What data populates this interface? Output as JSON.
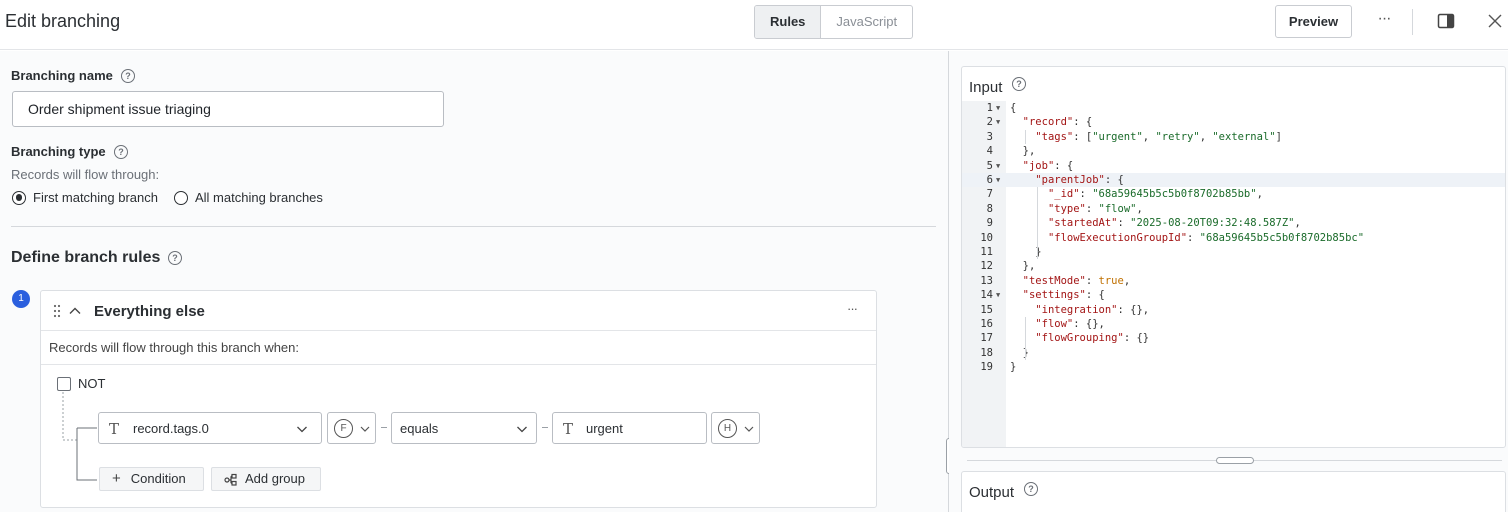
{
  "header": {
    "title": "Edit branching",
    "tabs": [
      {
        "label": "Rules",
        "active": true
      },
      {
        "label": "JavaScript",
        "active": false
      }
    ],
    "preview_label": "Preview",
    "more_label": "···"
  },
  "form": {
    "branching_name_label": "Branching name",
    "branching_name_value": "Order shipment issue triaging",
    "branching_type_label": "Branching type",
    "branching_type_hint": "Records will flow through:",
    "options": [
      {
        "label": "First matching branch",
        "selected": true
      },
      {
        "label": "All matching branches",
        "selected": false
      }
    ],
    "define_rules_title": "Define branch rules"
  },
  "branch": {
    "number": "1",
    "title": "Everything else",
    "more_label": "···",
    "subtitle": "Records will flow through this branch when:",
    "not_label": "NOT",
    "condition": {
      "field": "record.tags.0",
      "field_type_icon": "F",
      "operator": "equals",
      "value": "urgent",
      "value_type_icon": "H"
    },
    "add_condition_label": "Condition",
    "add_group_label": "Add group"
  },
  "input_panel": {
    "title": "Input",
    "highlighted_line": 6,
    "lines": [
      "{",
      "  \"record\": {",
      "    \"tags\": [\"urgent\", \"retry\", \"external\"]",
      "  },",
      "  \"job\": {",
      "    \"parentJob\": {",
      "      \"_id\": \"68a59645b5c5b0f8702b85bb\",",
      "      \"type\": \"flow\",",
      "      \"startedAt\": \"2025-08-20T09:32:48.587Z\",",
      "      \"flowExecutionGroupId\": \"68a59645b5c5b0f8702b85bc\"",
      "    }",
      "  },",
      "  \"testMode\": true,",
      "  \"settings\": {",
      "    \"integration\": {},",
      "    \"flow\": {},",
      "    \"flowGrouping\": {}",
      "  }",
      "}"
    ],
    "foldable_lines": [
      1,
      2,
      5,
      6,
      14
    ]
  },
  "output_panel": {
    "title": "Output"
  },
  "colors": {
    "accent": "#2b5fde",
    "json_key": "#a31515",
    "json_string": "#1a6b2a",
    "json_boolean": "#c07000"
  }
}
